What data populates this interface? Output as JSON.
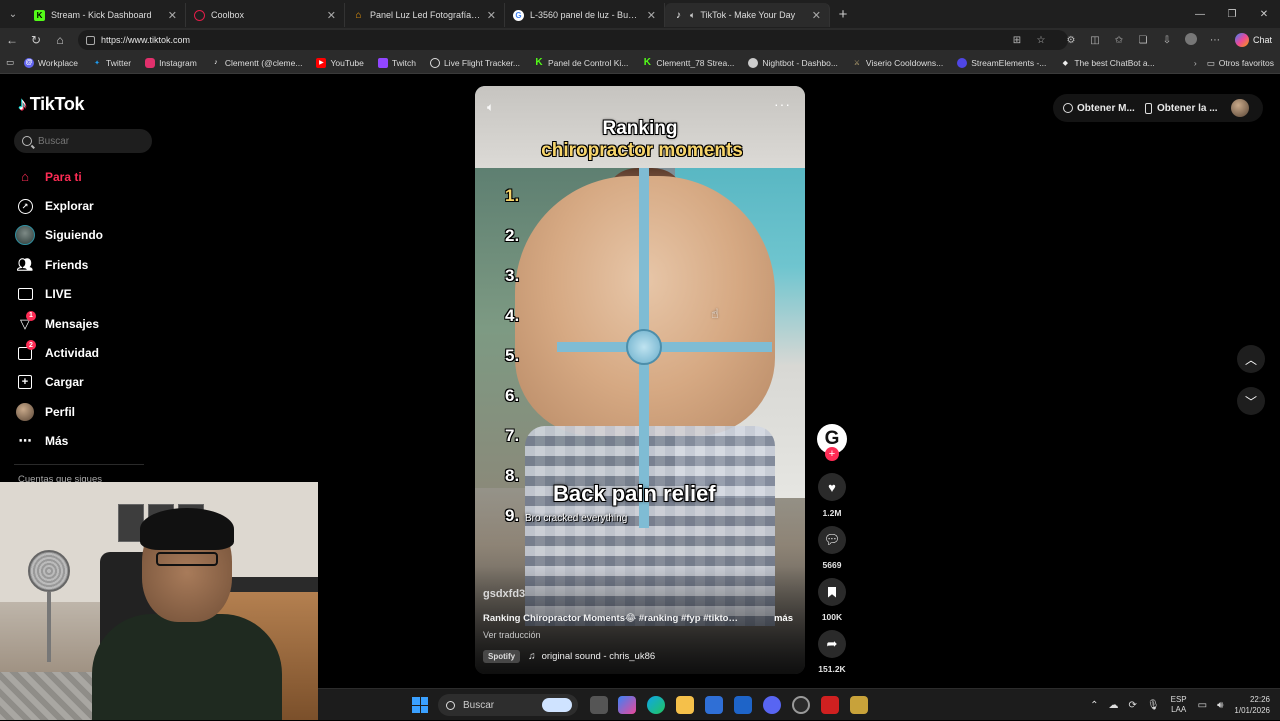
{
  "browser": {
    "tabs": [
      {
        "label": "Stream - Kick Dashboard",
        "icon": "kick-icon",
        "color": "#53fc18",
        "glyph": "K"
      },
      {
        "label": "Coolbox",
        "icon": "coolbox-icon",
        "color": "#e11d48",
        "glyph": "○"
      },
      {
        "label": "Panel Luz Led Fotografía Video Tr",
        "icon": "store-icon",
        "color": "#f59e0b",
        "glyph": "⌂"
      },
      {
        "label": "L-3560 panel de luz - Buscar con G",
        "icon": "google-icon",
        "color": "#ffffff",
        "glyph": "G"
      },
      {
        "label": "TikTok - Make Your Day",
        "icon": "tiktok-icon",
        "color": "#111111",
        "glyph": "♪"
      }
    ],
    "url": "https://www.tiktok.com",
    "chat_label": "Chat",
    "bookmarks": [
      {
        "label": "Workplace",
        "icon": "workplace-icon",
        "color": "#6366f1"
      },
      {
        "label": "Twitter",
        "icon": "twitter-icon",
        "color": "#1d9bf0"
      },
      {
        "label": "Instagram",
        "icon": "instagram-icon",
        "color": "#e1306c"
      },
      {
        "label": "Clementt (@cleme...",
        "icon": "tiktok-icon",
        "color": "#ffffff"
      },
      {
        "label": "YouTube",
        "icon": "youtube-icon",
        "color": "#ff0000"
      },
      {
        "label": "Twitch",
        "icon": "twitch-icon",
        "color": "#9146ff"
      },
      {
        "label": "Live Flight Tracker...",
        "icon": "flight-icon",
        "color": "#dddddd"
      },
      {
        "label": "Panel de Control Ki...",
        "icon": "kick-icon",
        "color": "#53fc18"
      },
      {
        "label": "Clementt_78 Strea...",
        "icon": "kick-icon",
        "color": "#53fc18"
      },
      {
        "label": "Nightbot - Dashbo...",
        "icon": "nightbot-icon",
        "color": "#dddddd"
      },
      {
        "label": "Viserio Cooldowns...",
        "icon": "viserio-icon",
        "color": "#c8b27a"
      },
      {
        "label": "StreamElements -...",
        "icon": "streamelements-icon",
        "color": "#4f46e5"
      },
      {
        "label": "The best ChatBot a...",
        "icon": "chatbot-icon",
        "color": "#eeeeee"
      }
    ],
    "other_favorites": "Otros favoritos"
  },
  "tiktok": {
    "logo": "TikTok",
    "search_placeholder": "Buscar",
    "nav": [
      {
        "label": "Para ti",
        "icon": "home-icon",
        "active": true,
        "badge": ""
      },
      {
        "label": "Explorar",
        "icon": "compass-icon",
        "active": false,
        "badge": ""
      },
      {
        "label": "Siguiendo",
        "icon": "following-avatar-icon",
        "active": false,
        "badge": ""
      },
      {
        "label": "Friends",
        "icon": "friends-icon",
        "active": false,
        "badge": ""
      },
      {
        "label": "LIVE",
        "icon": "live-icon",
        "active": false,
        "badge": ""
      },
      {
        "label": "Mensajes",
        "icon": "messages-icon",
        "active": false,
        "badge": "1"
      },
      {
        "label": "Actividad",
        "icon": "activity-icon",
        "active": false,
        "badge": "2"
      },
      {
        "label": "Cargar",
        "icon": "upload-icon",
        "active": false,
        "badge": ""
      },
      {
        "label": "Perfil",
        "icon": "profile-avatar-icon",
        "active": false,
        "badge": ""
      },
      {
        "label": "Más",
        "icon": "more-icon",
        "active": false,
        "badge": ""
      }
    ],
    "following_header": "Cuentas que sigues",
    "top_right": {
      "get_coins": "Obtener M...",
      "get_app": "Obtener la ..."
    },
    "video": {
      "title_line1": "Ranking",
      "title_line2": "chiropractor moments",
      "rank_numbers": [
        "1.",
        "2.",
        "3.",
        "4.",
        "5.",
        "6.",
        "7.",
        "8.",
        "9."
      ],
      "overlay_title": "Back pain relief",
      "overlay_subtitle": "Bro cracked everything",
      "username": "gsdxfd3",
      "description": "Ranking Chiropractor Moments😂 #ranking #fyp #tiktok...",
      "more_label": "más",
      "translate_label": "Ver traducción",
      "spotify_label": "Spotify",
      "sound": "original sound - chris_uk86"
    },
    "actions": {
      "creator_initial": "G",
      "likes": "1.2M",
      "comments": "5669",
      "saves": "100K",
      "shares": "151.2K"
    }
  },
  "taskbar": {
    "search_label": "Buscar",
    "lang_top": "ESP",
    "lang_bottom": "LAA",
    "time": "22:26",
    "date": "1/01/2026"
  }
}
